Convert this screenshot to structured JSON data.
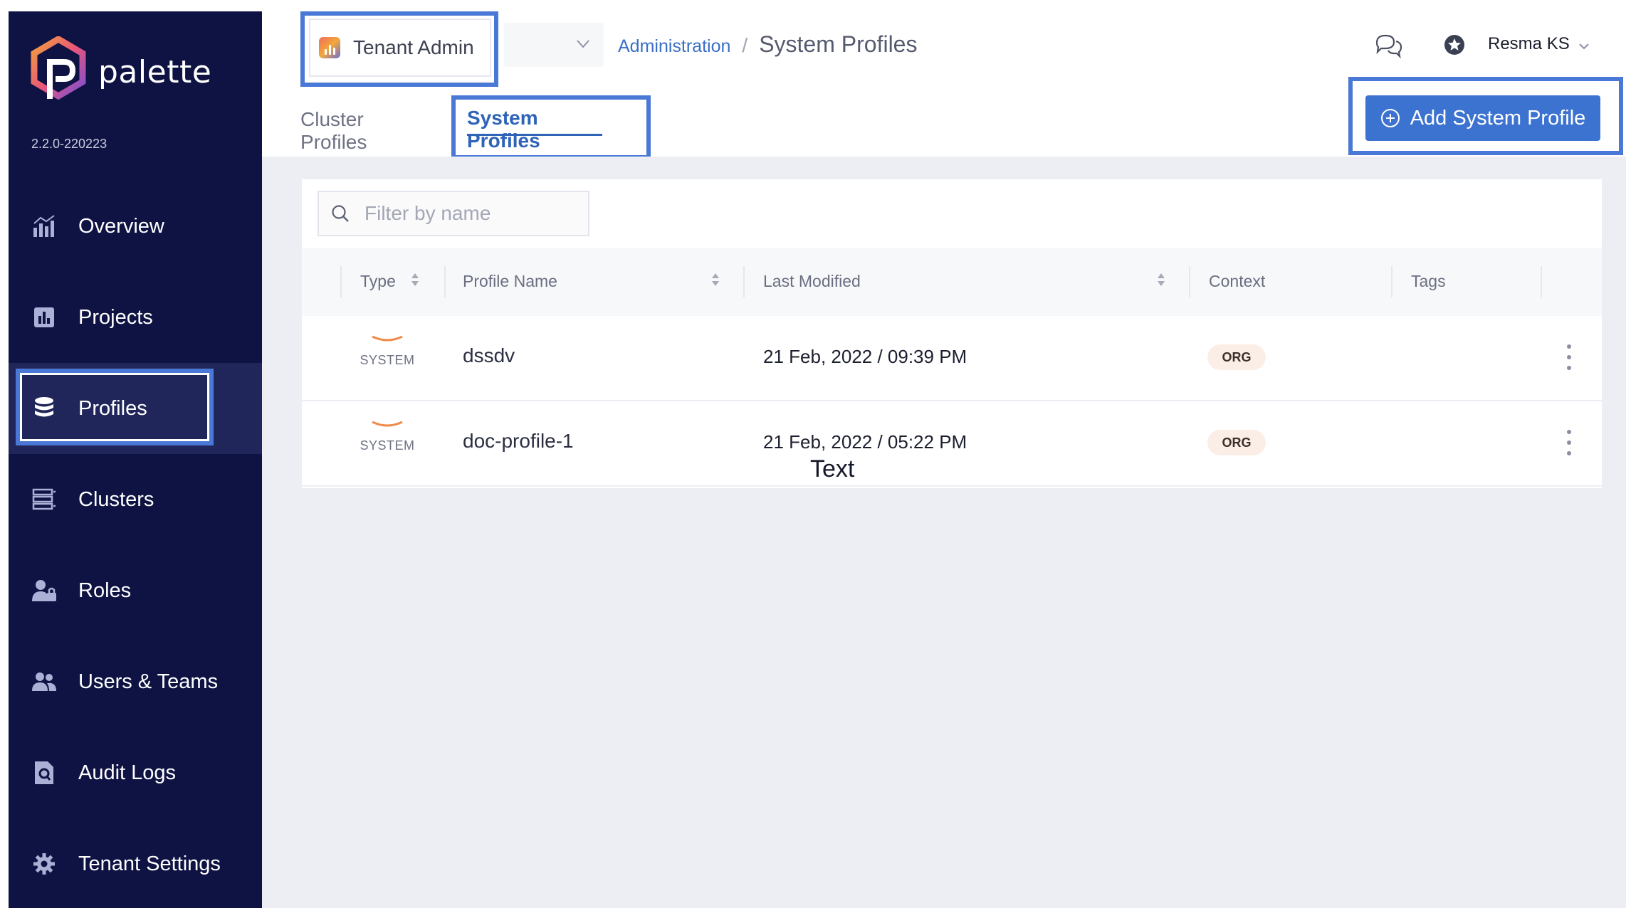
{
  "brand": {
    "name": "palette",
    "version": "2.2.0-220223"
  },
  "sidebar": {
    "items": [
      {
        "label": "Overview",
        "icon": "chart-icon"
      },
      {
        "label": "Projects",
        "icon": "projects-icon"
      },
      {
        "label": "Profiles",
        "icon": "database-icon",
        "active": true
      },
      {
        "label": "Clusters",
        "icon": "clusters-icon"
      },
      {
        "label": "Roles",
        "icon": "roles-icon"
      },
      {
        "label": "Users & Teams",
        "icon": "users-icon"
      },
      {
        "label": "Audit Logs",
        "icon": "audit-icon"
      },
      {
        "label": "Tenant Settings",
        "icon": "gear-icon"
      }
    ]
  },
  "header": {
    "scope": "Tenant Admin",
    "breadcrumb": {
      "parent": "Administration",
      "separator": "/",
      "current": "System Profiles"
    },
    "user": "Resma KS"
  },
  "tabs": {
    "cluster": "Cluster Profiles",
    "system": "System Profiles"
  },
  "actions": {
    "add_label": "Add System Profile"
  },
  "filter": {
    "placeholder": "Filter by name"
  },
  "table": {
    "columns": {
      "type": "Type",
      "name": "Profile Name",
      "modified": "Last Modified",
      "context": "Context",
      "tags": "Tags"
    },
    "rows": [
      {
        "type": "SYSTEM",
        "name": "dssdv",
        "modified": "21 Feb, 2022 / 09:39 PM",
        "context": "ORG"
      },
      {
        "type": "SYSTEM",
        "name": "doc-profile-1",
        "modified": "21 Feb, 2022 / 05:22 PM",
        "context": "ORG"
      }
    ]
  },
  "annotation": {
    "text": "Text"
  },
  "colors": {
    "sidebar": "#0f1343",
    "accent": "#3d73d0",
    "highlight": "#4a78d6",
    "system_mark": "#f08a4b"
  }
}
